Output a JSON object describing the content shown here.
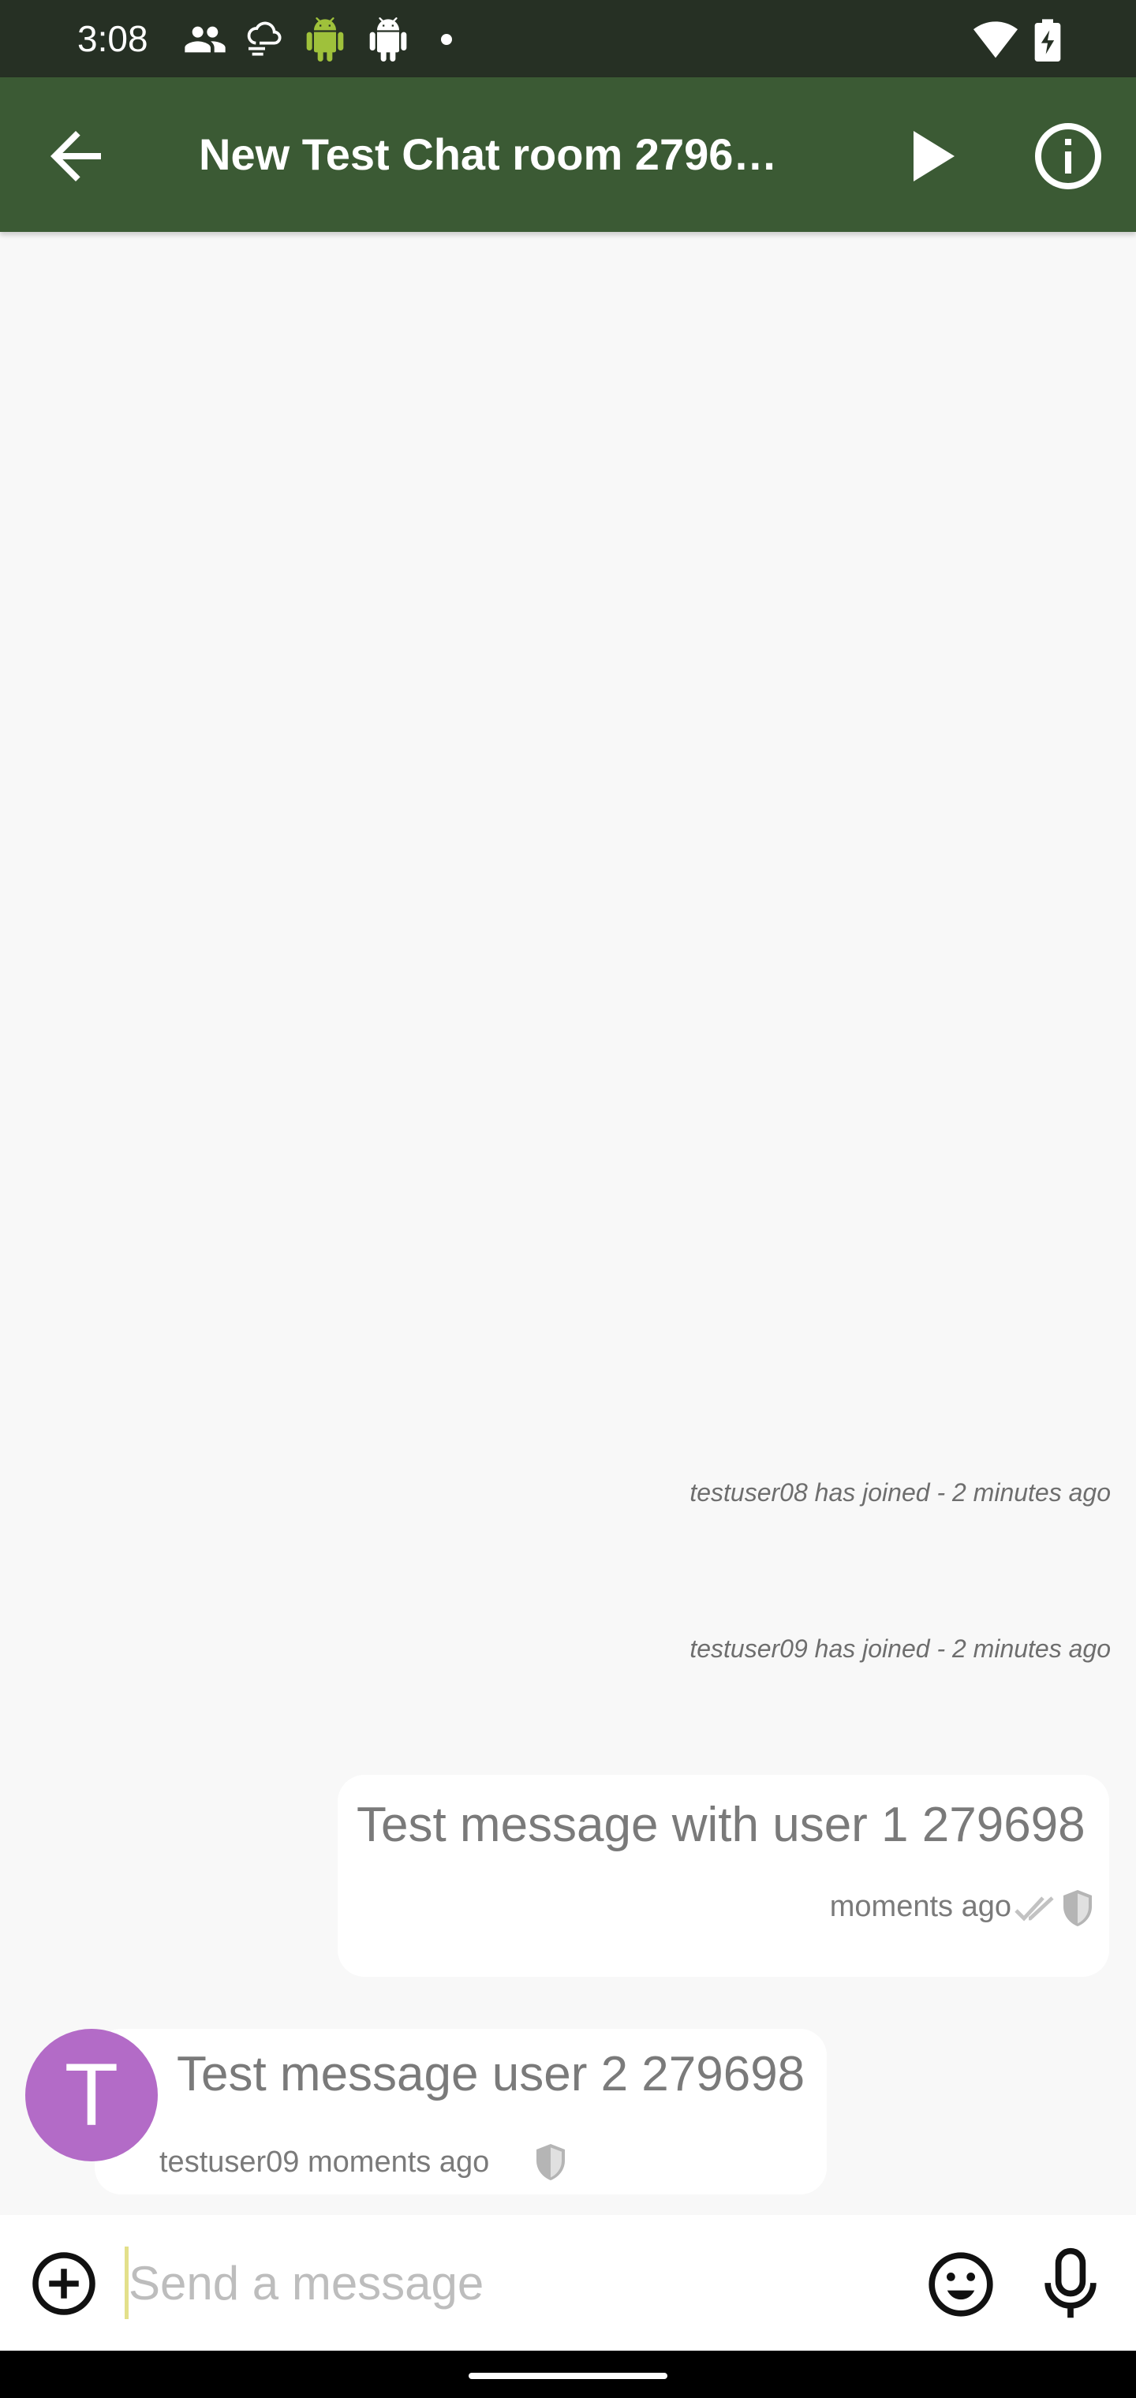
{
  "status_bar": {
    "time": "3:08",
    "icons": [
      "people-icon",
      "cloud-wind-icon",
      "android-green-icon",
      "android-white-icon",
      "dot-icon",
      "wifi-icon",
      "battery-charging-icon"
    ]
  },
  "app_bar": {
    "title": "New Test Chat room 2796…",
    "background_color": "#3b5a34"
  },
  "messages": {
    "system": [
      {
        "text": "testuser08 has joined - 2 minutes ago"
      },
      {
        "text": "testuser09 has joined - 2 minutes ago"
      }
    ],
    "outgoing": {
      "text": "Test message with user 1 279698",
      "time": "moments ago",
      "icons": [
        "double-check-icon",
        "shield-icon"
      ]
    },
    "incoming": {
      "avatar_letter": "T",
      "avatar_color": "#b36bc7",
      "text": "Test message user 2 279698",
      "sender": "testuser09",
      "time": "moments ago",
      "icons": [
        "shield-icon"
      ]
    }
  },
  "composer": {
    "placeholder": "Send a message",
    "value": ""
  }
}
